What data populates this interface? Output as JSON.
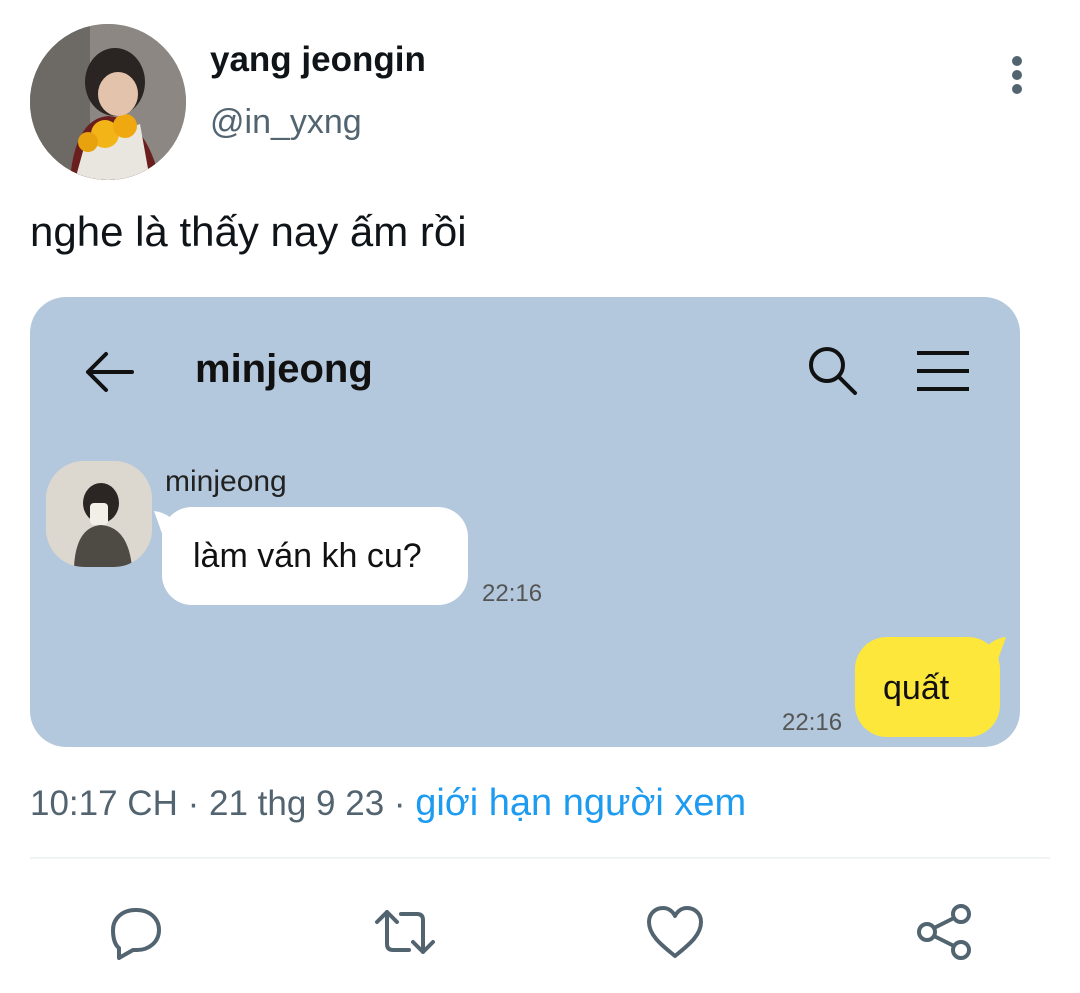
{
  "tweet": {
    "display_name": "yang jeongin",
    "handle": "@in_yxng",
    "text": "nghe là thấy nay ấm rồi",
    "time": "10:17 CH",
    "date": "21 thg 9 23",
    "separator": "·",
    "audience_link": "giới hạn người xem"
  },
  "chat": {
    "title": "minjeong",
    "messages": [
      {
        "sender": "minjeong",
        "text": "làm ván kh cu?",
        "time": "22:16",
        "direction": "incoming"
      },
      {
        "sender": "",
        "text": "quất",
        "time": "22:16",
        "direction": "outgoing"
      }
    ],
    "colors": {
      "background": "#b3c8dd",
      "incoming_bubble": "#ffffff",
      "outgoing_bubble": "#fde73b"
    }
  },
  "icons": {
    "header": [
      "more-vertical-icon"
    ],
    "chat_header": [
      "back-arrow-icon",
      "search-icon",
      "menu-icon"
    ],
    "actions": [
      "reply-icon",
      "retweet-icon",
      "like-icon",
      "share-icon"
    ]
  },
  "colors": {
    "link": "#1d9bf0",
    "secondary_text": "#536471",
    "primary_text": "#0f1419"
  }
}
